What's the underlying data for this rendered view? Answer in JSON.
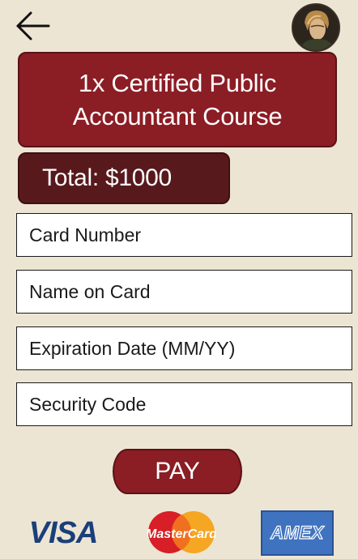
{
  "header": {
    "back_icon": "arrow-left-icon",
    "avatar_icon": "user-avatar-icon"
  },
  "order": {
    "item_title": "1x Certified Public Accountant Course",
    "total": "Total: $1000"
  },
  "form": {
    "card_number_placeholder": "Card Number",
    "name_on_card_placeholder": "Name on Card",
    "expiration_placeholder": "Expiration Date (MM/YY)",
    "security_code_placeholder": "Security Code",
    "pay_label": "PAY"
  },
  "payment_logos": {
    "visa": "VISA",
    "mastercard": "MasterCard",
    "amex": "AMEX"
  },
  "colors": {
    "background": "#ede5d3",
    "primary": "#8b1d24",
    "total_bg": "#58191d",
    "visa_blue": "#1a3f7a",
    "amex_blue": "#3f73c0"
  }
}
